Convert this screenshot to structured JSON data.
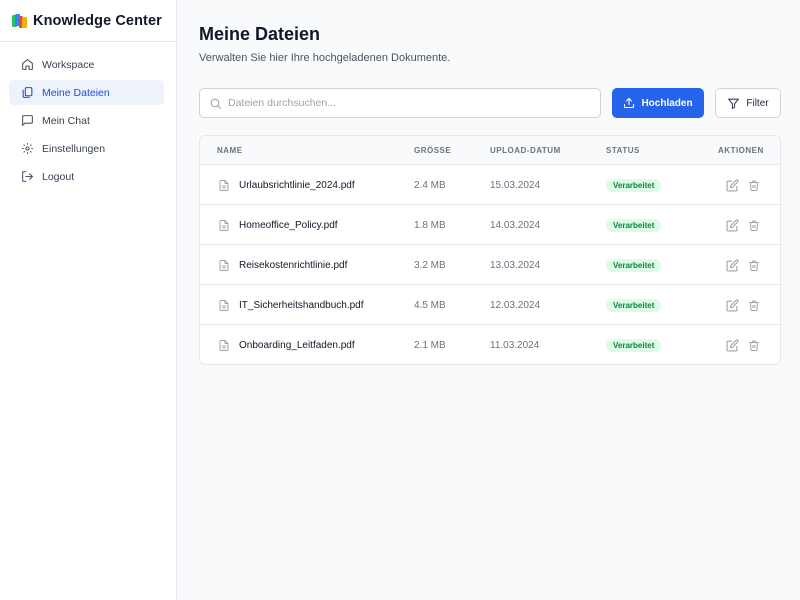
{
  "app": {
    "brand_title": "Knowledge Center"
  },
  "sidebar": {
    "items": [
      {
        "label": "Workspace",
        "icon": "home-icon"
      },
      {
        "label": "Meine Dateien",
        "icon": "documents-icon",
        "active": true
      },
      {
        "label": "Mein Chat",
        "icon": "chat-icon"
      },
      {
        "label": "Einstellungen",
        "icon": "gear-icon"
      },
      {
        "label": "Logout",
        "icon": "logout-icon"
      }
    ]
  },
  "main": {
    "title": "Meine Dateien",
    "subtitle": "Verwalten Sie hier Ihre hochgeladenen Dokumente.",
    "search_placeholder": "Dateien durchsuchen...",
    "upload_label": "Hochladen",
    "filter_label": "Filter"
  },
  "table": {
    "headers": {
      "name": "NAME",
      "size": "GRÖSSE",
      "date": "UPLOAD-DATUM",
      "status": "STATUS",
      "actions": "AKTIONEN"
    },
    "rows": [
      {
        "name": "Urlaubsrichtlinie_2024.pdf",
        "size": "2.4 MB",
        "date": "15.03.2024",
        "status": "Verarbeitet"
      },
      {
        "name": "Homeoffice_Policy.pdf",
        "size": "1.8 MB",
        "date": "14.03.2024",
        "status": "Verarbeitet"
      },
      {
        "name": "Reisekostenrichtlinie.pdf",
        "size": "3.2 MB",
        "date": "13.03.2024",
        "status": "Verarbeitet"
      },
      {
        "name": "IT_Sicherheitshandbuch.pdf",
        "size": "4.5 MB",
        "date": "12.03.2024",
        "status": "Verarbeitet"
      },
      {
        "name": "Onboarding_Leitfaden.pdf",
        "size": "2.1 MB",
        "date": "11.03.2024",
        "status": "Verarbeitet"
      }
    ]
  },
  "colors": {
    "accent": "#2563eb",
    "active_nav_bg": "#eef2fb",
    "status_bg": "#dcfce7",
    "status_text": "#15803d",
    "logo": [
      "#22c55e",
      "#3b82f6",
      "#ef4444",
      "#eab308"
    ]
  }
}
